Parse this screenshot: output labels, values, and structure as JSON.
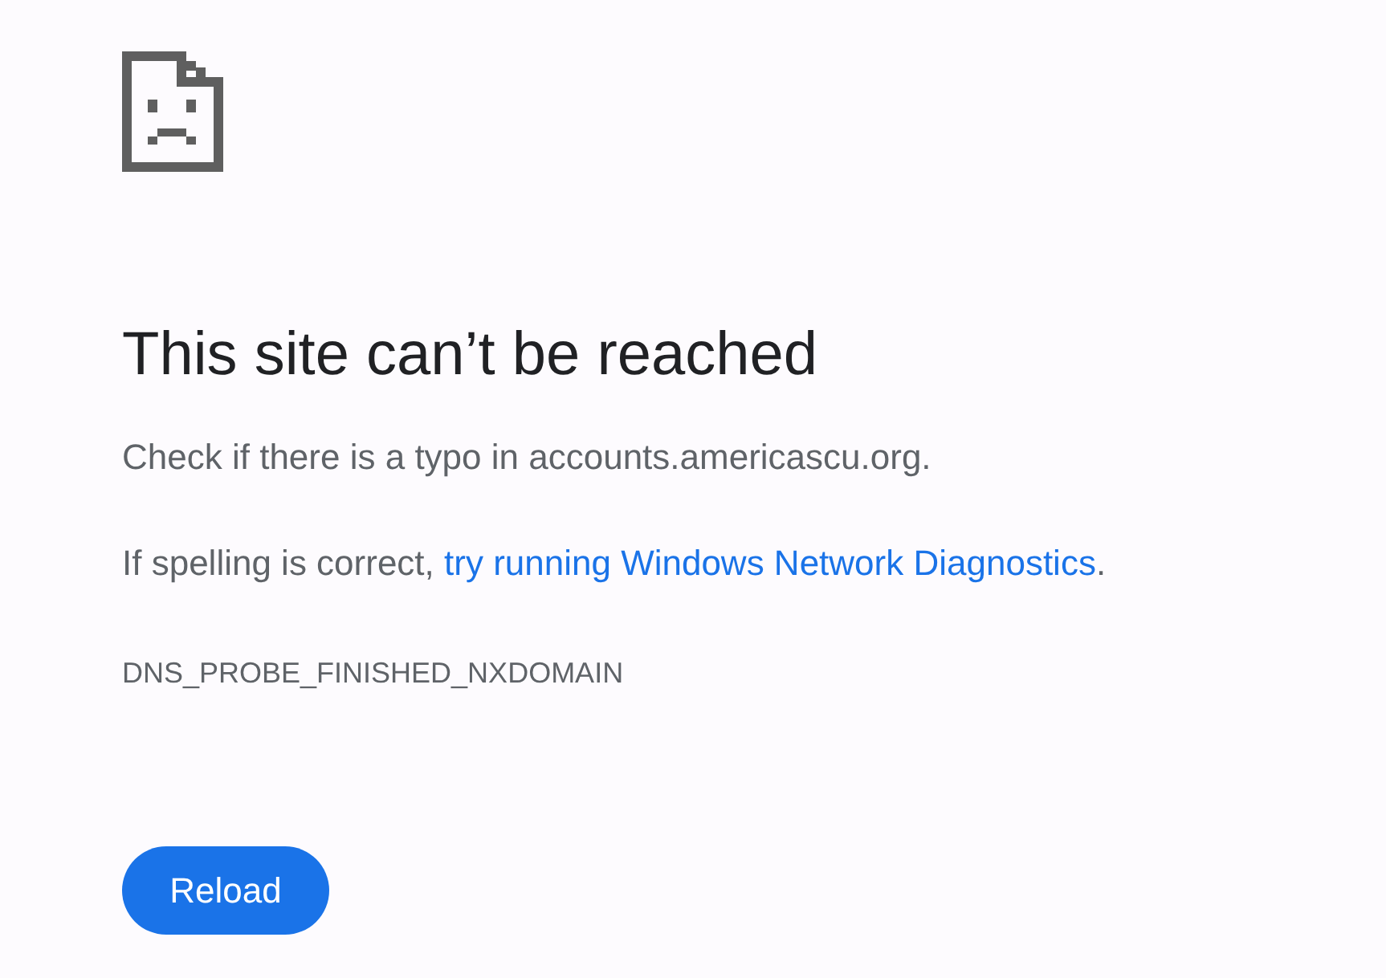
{
  "heading": "This site can’t be reached",
  "message": "Check if there is a typo in accounts.americascu.org.",
  "suggestion": {
    "before": "If spelling is correct, ",
    "link": "try running Windows Network Diagnostics",
    "after": "."
  },
  "error_code": "DNS_PROBE_FINISHED_NXDOMAIN",
  "button": "Reload"
}
